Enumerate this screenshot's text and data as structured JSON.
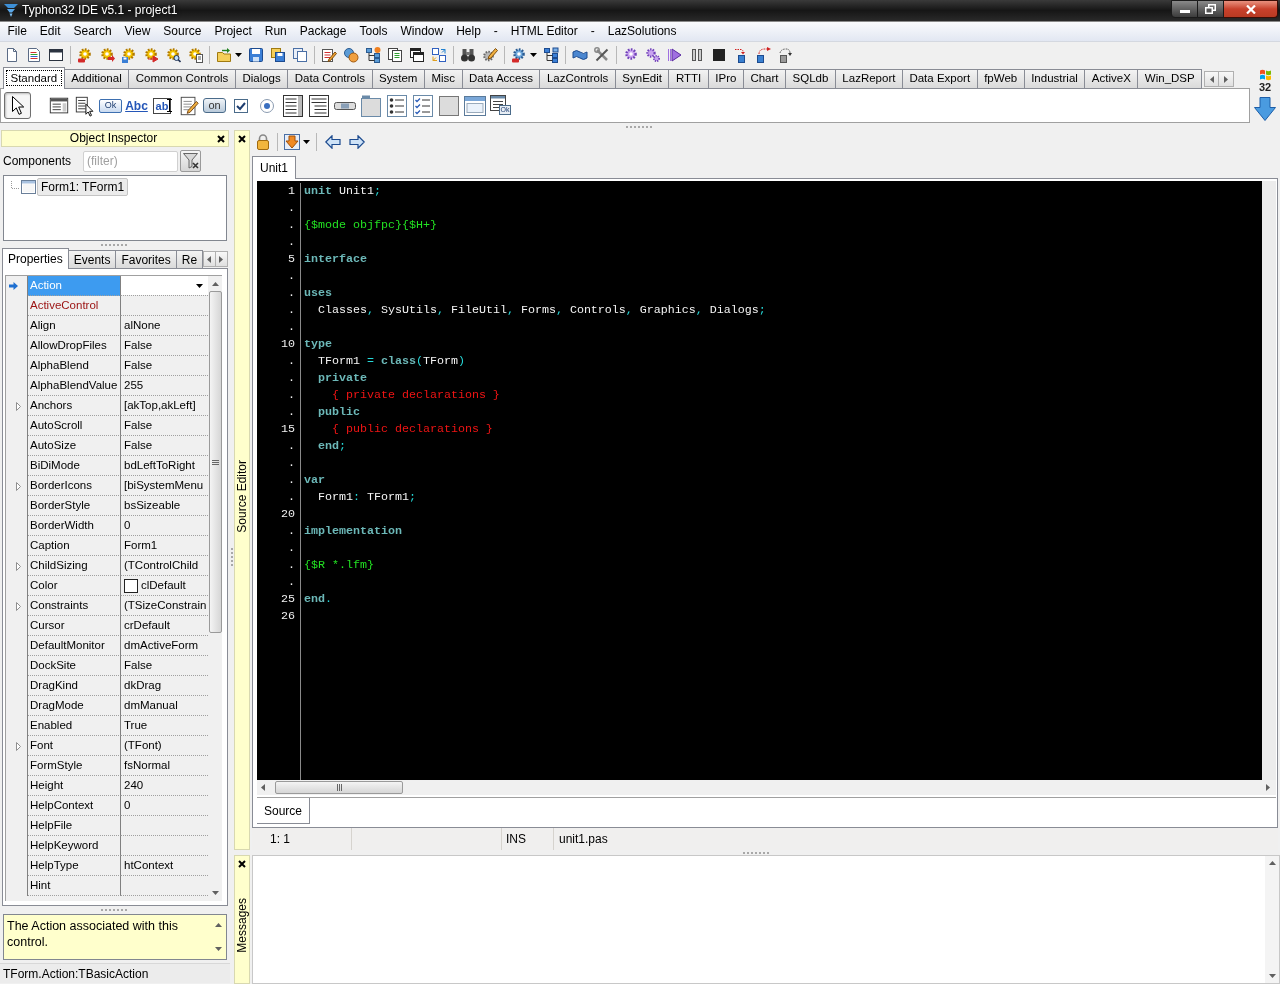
{
  "window": {
    "title": "Typhon32 IDE v5.1 - project1"
  },
  "menu": [
    "File",
    "Edit",
    "Search",
    "View",
    "Source",
    "Project",
    "Run",
    "Package",
    "Tools",
    "Window",
    "Help",
    "-",
    "HTML Editor",
    "-",
    "LazSolutions"
  ],
  "palette": {
    "tabs": [
      {
        "label": "Standard",
        "selected": true
      },
      {
        "label": "Additional",
        "selected": false
      },
      {
        "label": "Common Controls",
        "selected": false
      },
      {
        "label": "Dialogs",
        "selected": false
      },
      {
        "label": "Data Controls",
        "selected": false
      },
      {
        "label": "System",
        "selected": false
      },
      {
        "label": "Misc",
        "selected": false
      },
      {
        "label": "Data Access",
        "selected": false
      },
      {
        "label": "LazControls",
        "selected": false
      },
      {
        "label": "SynEdit",
        "selected": false
      },
      {
        "label": "RTTI",
        "selected": false
      },
      {
        "label": "IPro",
        "selected": false
      },
      {
        "label": "Chart",
        "selected": false
      },
      {
        "label": "SQLdb",
        "selected": false
      },
      {
        "label": "LazReport",
        "selected": false
      },
      {
        "label": "Data Export",
        "selected": false
      },
      {
        "label": "fpWeb",
        "selected": false
      },
      {
        "label": "Industrial",
        "selected": false
      },
      {
        "label": "ActiveX",
        "selected": false
      },
      {
        "label": "Win_DSP",
        "selected": false
      }
    ],
    "components": [
      {
        "selected": true
      },
      {
        "selected": false
      },
      {
        "selected": false
      },
      {
        "label": "Ok",
        "selected": false
      },
      {
        "label": "Abc",
        "selected": false
      },
      {
        "label": "ab",
        "selected": false
      },
      {
        "selected": false
      },
      {
        "label": "on",
        "selected": false
      },
      {
        "selected": false
      },
      {
        "selected": false
      },
      {
        "selected": false
      },
      {
        "selected": false
      },
      {
        "selected": false
      },
      {
        "selected": false
      },
      {
        "selected": false
      },
      {
        "selected": false
      },
      {
        "selected": false
      },
      {
        "selected": false
      },
      {
        "label": "Ok",
        "selected": false
      }
    ],
    "platform_label": "32"
  },
  "object_inspector": {
    "title": "Object Inspector",
    "components_label": "Components",
    "filter": {
      "placeholder": "(filter)"
    },
    "tree": [
      {
        "label": "Form1: TForm1",
        "selected": true
      }
    ],
    "tabs": [
      {
        "label": "Properties",
        "selected": true
      },
      {
        "label": "Events",
        "selected": false
      },
      {
        "label": "Favorites",
        "selected": false
      },
      {
        "label": "Re",
        "selected": false
      }
    ],
    "properties": [
      {
        "name": "Action",
        "kind": "plain",
        "selected": true
      },
      {
        "name": "ActiveControl",
        "kind": "reference",
        "selected": false
      },
      {
        "name": "Align",
        "value": "alNone",
        "kind": "plain",
        "selected": false
      },
      {
        "name": "AllowDropFiles",
        "value": "False",
        "kind": "plain",
        "selected": false
      },
      {
        "name": "AlphaBlend",
        "value": "False",
        "kind": "plain",
        "selected": false
      },
      {
        "name": "AlphaBlendValue",
        "value": "255",
        "kind": "plain",
        "selected": false
      },
      {
        "name": "Anchors",
        "value": "[akTop,akLeft]",
        "kind": "expandable",
        "selected": false
      },
      {
        "name": "AutoScroll",
        "value": "False",
        "kind": "plain",
        "selected": false
      },
      {
        "name": "AutoSize",
        "value": "False",
        "kind": "plain",
        "selected": false
      },
      {
        "name": "BiDiMode",
        "value": "bdLeftToRight",
        "kind": "plain",
        "selected": false
      },
      {
        "name": "BorderIcons",
        "value": "[biSystemMenu",
        "kind": "expandable",
        "selected": false
      },
      {
        "name": "BorderStyle",
        "value": "bsSizeable",
        "kind": "plain",
        "selected": false
      },
      {
        "name": "BorderWidth",
        "value": "0",
        "kind": "plain",
        "selected": false
      },
      {
        "name": "Caption",
        "value": "Form1",
        "kind": "plain",
        "selected": false
      },
      {
        "name": "ChildSizing",
        "value": "(TControlChild",
        "kind": "expandable",
        "selected": false
      },
      {
        "name": "Color",
        "value": "clDefault",
        "kind": "color",
        "selected": false
      },
      {
        "name": "Constraints",
        "value": "(TSizeConstrain",
        "kind": "expandable",
        "selected": false
      },
      {
        "name": "Cursor",
        "value": "crDefault",
        "kind": "plain",
        "selected": false
      },
      {
        "name": "DefaultMonitor",
        "value": "dmActiveForm",
        "kind": "plain",
        "selected": false
      },
      {
        "name": "DockSite",
        "value": "False",
        "kind": "plain",
        "selected": false
      },
      {
        "name": "DragKind",
        "value": "dkDrag",
        "kind": "plain",
        "selected": false
      },
      {
        "name": "DragMode",
        "value": "dmManual",
        "kind": "plain",
        "selected": false
      },
      {
        "name": "Enabled",
        "value": "True",
        "kind": "plain",
        "selected": false
      },
      {
        "name": "Font",
        "value": "(TFont)",
        "kind": "expandable",
        "selected": false
      },
      {
        "name": "FormStyle",
        "value": "fsNormal",
        "kind": "plain",
        "selected": false
      },
      {
        "name": "Height",
        "value": "240",
        "kind": "plain",
        "selected": false
      },
      {
        "name": "HelpContext",
        "value": "0",
        "kind": "plain",
        "selected": false
      },
      {
        "name": "HelpFile",
        "kind": "plain",
        "selected": false
      },
      {
        "name": "HelpKeyword",
        "kind": "plain",
        "selected": false
      },
      {
        "name": "HelpType",
        "value": "htContext",
        "kind": "plain",
        "selected": false
      },
      {
        "name": "Hint",
        "kind": "plain",
        "selected": false
      }
    ],
    "description": "The Action associated with this control.",
    "status": "TForm.Action:TBasicAction"
  },
  "source_editor": {
    "title": "Source Editor",
    "tabs": [
      {
        "label": "Unit1",
        "selected": true
      }
    ],
    "lines": [
      {
        "number": "1",
        "tokens": [
          {
            "kind": "keyword",
            "text": "unit"
          },
          {
            "kind": "identifier",
            "text": " Unit1"
          },
          {
            "kind": "symbol",
            "text": ";"
          }
        ]
      },
      {
        "number": "."
      },
      {
        "number": ".",
        "tokens": [
          {
            "kind": "directive",
            "text": "{$mode objfpc}{$H+}"
          }
        ]
      },
      {
        "number": "."
      },
      {
        "number": "5",
        "tokens": [
          {
            "kind": "keyword",
            "text": "interface"
          }
        ]
      },
      {
        "number": "."
      },
      {
        "number": ".",
        "tokens": [
          {
            "kind": "keyword",
            "text": "uses"
          }
        ]
      },
      {
        "number": ".",
        "tokens": [
          {
            "kind": "identifier",
            "text": "  Classes"
          },
          {
            "kind": "symbol",
            "text": ","
          },
          {
            "kind": "identifier",
            "text": " SysUtils"
          },
          {
            "kind": "symbol",
            "text": ","
          },
          {
            "kind": "identifier",
            "text": " FileUtil"
          },
          {
            "kind": "symbol",
            "text": ","
          },
          {
            "kind": "identifier",
            "text": " Forms"
          },
          {
            "kind": "symbol",
            "text": ","
          },
          {
            "kind": "identifier",
            "text": " Controls"
          },
          {
            "kind": "symbol",
            "text": ","
          },
          {
            "kind": "identifier",
            "text": " Graphics"
          },
          {
            "kind": "symbol",
            "text": ","
          },
          {
            "kind": "identifier",
            "text": " Dialogs"
          },
          {
            "kind": "symbol",
            "text": ";"
          }
        ]
      },
      {
        "number": "."
      },
      {
        "number": "10",
        "tokens": [
          {
            "kind": "keyword",
            "text": "type"
          }
        ]
      },
      {
        "number": ".",
        "tokens": [
          {
            "kind": "identifier",
            "text": "  TForm1"
          },
          {
            "kind": "symbol",
            "text": " ="
          },
          {
            "kind": "keyword",
            "text": " class"
          },
          {
            "kind": "symbol",
            "text": "("
          },
          {
            "kind": "identifier",
            "text": "TForm"
          },
          {
            "kind": "symbol",
            "text": ")"
          }
        ]
      },
      {
        "number": ".",
        "tokens": [
          {
            "kind": "keyword",
            "text": "  private"
          }
        ]
      },
      {
        "number": ".",
        "tokens": [
          {
            "kind": "comment",
            "text": "    { private declarations }"
          }
        ]
      },
      {
        "number": ".",
        "tokens": [
          {
            "kind": "keyword",
            "text": "  public"
          }
        ]
      },
      {
        "number": "15",
        "tokens": [
          {
            "kind": "comment",
            "text": "    { public declarations }"
          }
        ]
      },
      {
        "number": ".",
        "tokens": [
          {
            "kind": "keyword",
            "text": "  end"
          },
          {
            "kind": "symbol",
            "text": ";"
          }
        ]
      },
      {
        "number": "."
      },
      {
        "number": ".",
        "tokens": [
          {
            "kind": "keyword",
            "text": "var"
          }
        ]
      },
      {
        "number": ".",
        "tokens": [
          {
            "kind": "identifier",
            "text": "  Form1"
          },
          {
            "kind": "symbol",
            "text": ":"
          },
          {
            "kind": "identifier",
            "text": " TForm1"
          },
          {
            "kind": "symbol",
            "text": ";"
          }
        ]
      },
      {
        "number": "20"
      },
      {
        "number": ".",
        "tokens": [
          {
            "kind": "keyword",
            "text": "implementation"
          }
        ]
      },
      {
        "number": "."
      },
      {
        "number": ".",
        "tokens": [
          {
            "kind": "directive",
            "text": "{$R *.lfm}"
          }
        ]
      },
      {
        "number": "."
      },
      {
        "number": "25",
        "tokens": [
          {
            "kind": "keyword",
            "text": "end"
          },
          {
            "kind": "symbol",
            "text": "."
          }
        ]
      },
      {
        "number": "26"
      }
    ],
    "view_tabs": [
      {
        "label": "Source",
        "selected": true
      }
    ],
    "status_bar": {
      "position": "1: 1",
      "mode": "INS",
      "file": "unit1.pas"
    }
  },
  "messages": {
    "title": "Messages"
  }
}
